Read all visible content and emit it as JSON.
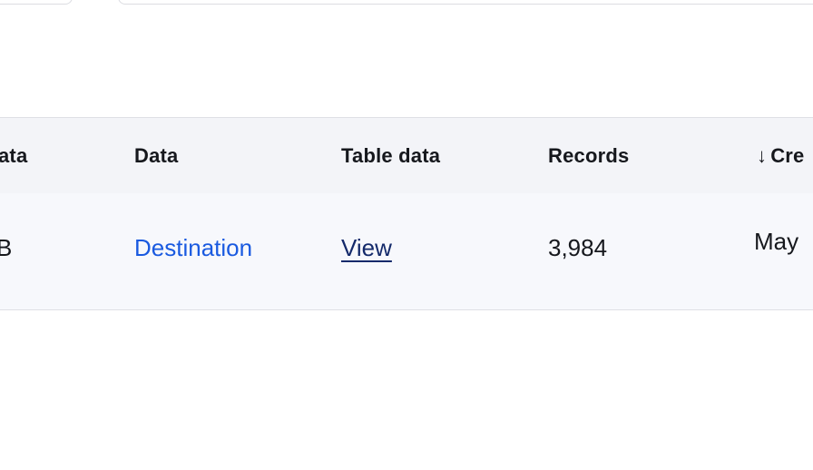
{
  "top_fields": [
    {
      "value": ""
    },
    {
      "value": ""
    }
  ],
  "table": {
    "columns": [
      "ata",
      "Data",
      "Table data",
      "Records",
      "Cre"
    ],
    "sort_icon": "arrow-down-icon",
    "sort_glyph": "↓",
    "rows": [
      {
        "col0": "B",
        "data": "Destination",
        "table_data": "View",
        "records": "3,984",
        "created": "May"
      }
    ],
    "colors": {
      "link": "#1a5ae0",
      "view_link": "#142a6b",
      "header_bg": "#f3f4f8",
      "row_bg": "#f7f8fc"
    }
  }
}
